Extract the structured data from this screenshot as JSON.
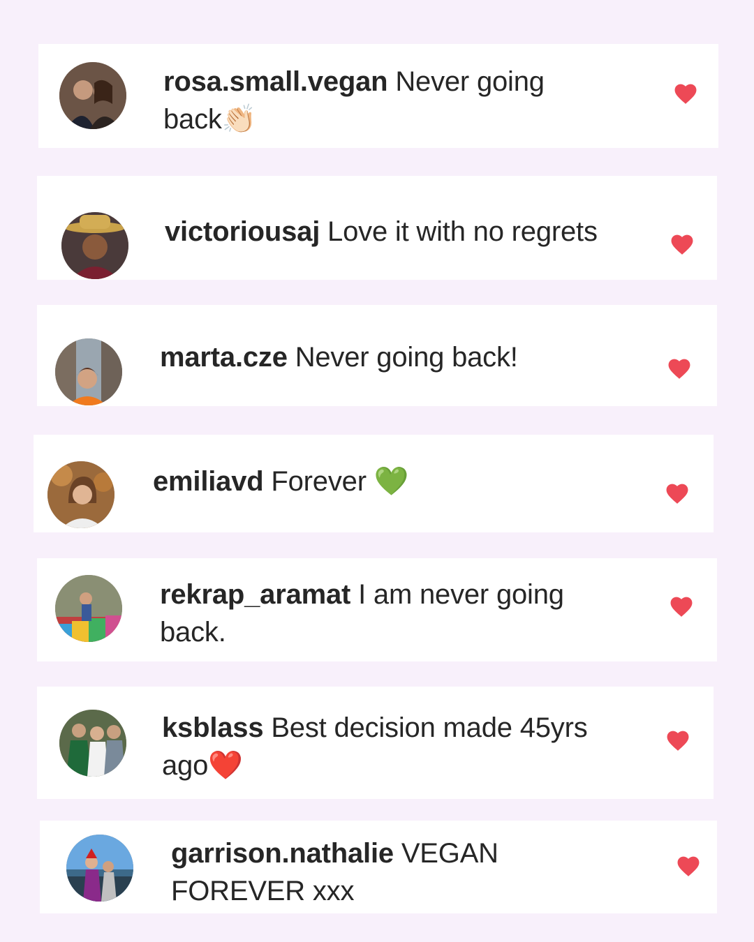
{
  "comments": [
    {
      "username": "rosa.small.vegan",
      "text": "Never going back",
      "emoji": "👏🏻",
      "liked": true
    },
    {
      "username": "victoriousaj",
      "text": "Love it with no regrets",
      "emoji": "",
      "liked": true
    },
    {
      "username": "marta.cze",
      "text": "Never going back!",
      "emoji": "",
      "liked": true
    },
    {
      "username": "emiliavd",
      "text": "Forever ",
      "emoji": "💚",
      "liked": true
    },
    {
      "username": "rekrap_aramat",
      "text": "I am never going back.",
      "emoji": "",
      "liked": true
    },
    {
      "username": "ksblass",
      "text": "Best decision made 45yrs ago",
      "emoji": "❤️",
      "liked": true
    },
    {
      "username": "garrison.nathalie",
      "text": "VEGAN FOREVER xxx",
      "emoji": "",
      "liked": true
    }
  ],
  "colors": {
    "background": "#f8f0fb",
    "card": "#ffffff",
    "heart": "#ed4956",
    "text": "#262626"
  }
}
